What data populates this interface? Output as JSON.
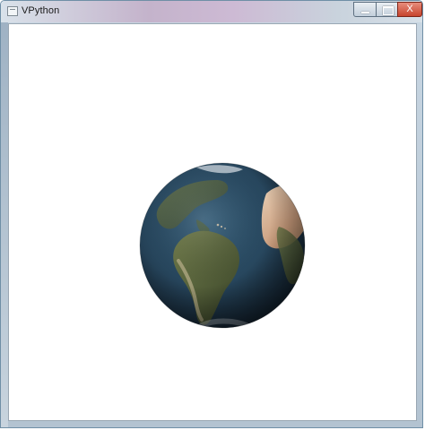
{
  "window": {
    "title": "VPython",
    "controls": {
      "minimize": "minimize",
      "maximize": "maximize",
      "close_glyph": "X"
    }
  },
  "scene": {
    "object": "earth-sphere",
    "background_color": "#ffffff"
  },
  "colors": {
    "ocean": "#27445a",
    "land_green": "#4f5a36",
    "land_desert": "#c9a47e"
  }
}
